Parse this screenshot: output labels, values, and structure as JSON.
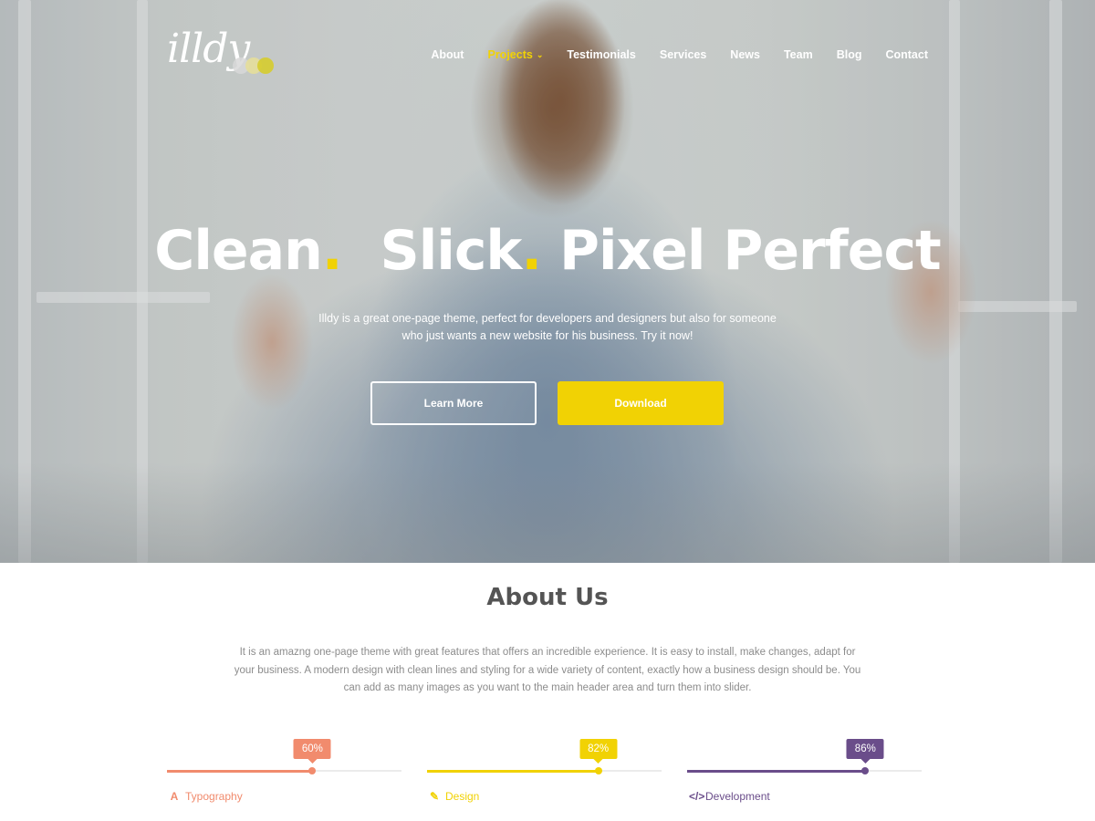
{
  "logo": {
    "text": "illdy",
    "dot_colors": [
      "#d8d8d8",
      "#e6de9a",
      "#d6cc2e"
    ]
  },
  "nav": {
    "items": [
      {
        "label": "About"
      },
      {
        "label": "Projects",
        "active": true,
        "has_submenu": true
      },
      {
        "label": "Testimonials"
      },
      {
        "label": "Services"
      },
      {
        "label": "News"
      },
      {
        "label": "Team"
      },
      {
        "label": "Blog"
      },
      {
        "label": "Contact"
      }
    ]
  },
  "hero": {
    "headline_words": [
      "Clean",
      "Slick",
      "Pixel Perfect"
    ],
    "headline_dot": ".",
    "subtitle": "Illdy is a great one-page theme, perfect for developers and designers but also for someone who just wants a new website for his business. Try it now!",
    "learn_more_label": "Learn More",
    "download_label": "Download"
  },
  "about": {
    "title": "About Us",
    "text": "It is an amazng one-page theme with great features that offers an incredible experience. It is easy to install, make changes, adapt for your business. A modern design with clean lines and styling for a wide variety of content, exactly how a business design should be. You can add as many images as you want to the main header area and turn them into slider."
  },
  "skills": [
    {
      "label": "Typography",
      "percent_label": "60%",
      "value": 0.62,
      "color": "#f18b6d",
      "icon": "font-icon"
    },
    {
      "label": "Design",
      "percent_label": "82%",
      "value": 0.73,
      "color": "#f1d204",
      "icon": "pencil-icon"
    },
    {
      "label": "Development",
      "percent_label": "86%",
      "value": 0.76,
      "color": "#6a4d8a",
      "icon": "code-icon"
    }
  ],
  "colors": {
    "accent_yellow": "#f1d204",
    "heading": "#545454",
    "body_text": "#8c8c8c"
  }
}
